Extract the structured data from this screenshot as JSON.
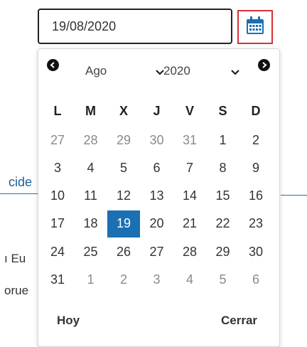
{
  "background": {
    "link_fragment": "cide",
    "text_fragment_1": "ı Eu",
    "text_fragment_2": "orue"
  },
  "date_field": {
    "value": "19/08/2020"
  },
  "calendar_button": {
    "icon": "calendar-icon",
    "border_color": "#d6313a",
    "icon_color": "#1b6fb3"
  },
  "datepicker": {
    "month_selected": "Ago",
    "year_selected": "2020",
    "weekdays": [
      "L",
      "M",
      "X",
      "J",
      "V",
      "S",
      "D"
    ],
    "weeks": [
      [
        {
          "d": "27",
          "other": true
        },
        {
          "d": "28",
          "other": true
        },
        {
          "d": "29",
          "other": true
        },
        {
          "d": "30",
          "other": true
        },
        {
          "d": "31",
          "other": true
        },
        {
          "d": "1",
          "other": false
        },
        {
          "d": "2",
          "other": false
        }
      ],
      [
        {
          "d": "3",
          "other": false
        },
        {
          "d": "4",
          "other": false
        },
        {
          "d": "5",
          "other": false
        },
        {
          "d": "6",
          "other": false
        },
        {
          "d": "7",
          "other": false
        },
        {
          "d": "8",
          "other": false
        },
        {
          "d": "9",
          "other": false
        }
      ],
      [
        {
          "d": "10",
          "other": false
        },
        {
          "d": "11",
          "other": false
        },
        {
          "d": "12",
          "other": false
        },
        {
          "d": "13",
          "other": false
        },
        {
          "d": "14",
          "other": false
        },
        {
          "d": "15",
          "other": false
        },
        {
          "d": "16",
          "other": false
        }
      ],
      [
        {
          "d": "17",
          "other": false
        },
        {
          "d": "18",
          "other": false
        },
        {
          "d": "19",
          "other": false,
          "selected": true
        },
        {
          "d": "20",
          "other": false
        },
        {
          "d": "21",
          "other": false
        },
        {
          "d": "22",
          "other": false
        },
        {
          "d": "23",
          "other": false
        }
      ],
      [
        {
          "d": "24",
          "other": false
        },
        {
          "d": "25",
          "other": false
        },
        {
          "d": "26",
          "other": false
        },
        {
          "d": "27",
          "other": false
        },
        {
          "d": "28",
          "other": false
        },
        {
          "d": "29",
          "other": false
        },
        {
          "d": "30",
          "other": false
        }
      ],
      [
        {
          "d": "31",
          "other": false
        },
        {
          "d": "1",
          "other": true
        },
        {
          "d": "2",
          "other": true
        },
        {
          "d": "3",
          "other": true
        },
        {
          "d": "4",
          "other": true
        },
        {
          "d": "5",
          "other": true
        },
        {
          "d": "6",
          "other": true
        }
      ]
    ],
    "today_label": "Hoy",
    "close_label": "Cerrar",
    "selected_color": "#1b6fb3"
  }
}
